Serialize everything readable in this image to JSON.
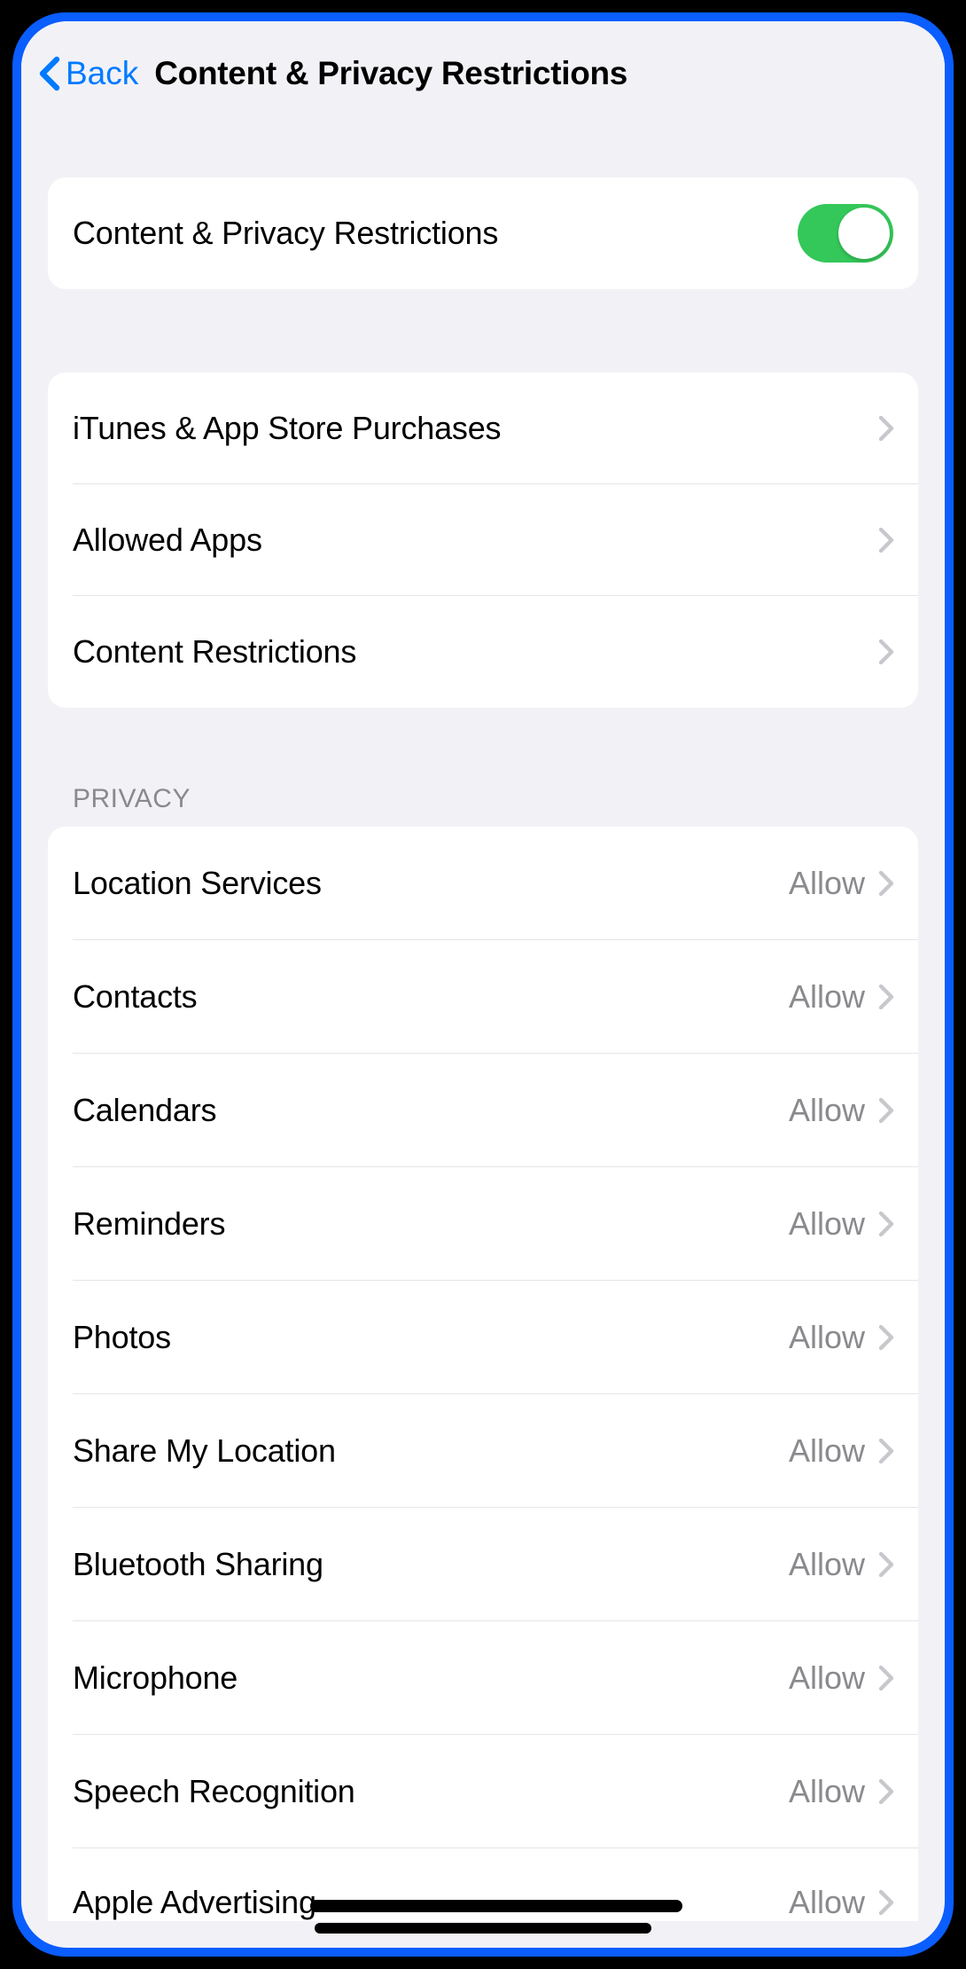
{
  "nav": {
    "back_label": "Back",
    "title": "Content & Privacy Restrictions"
  },
  "toggle_section": {
    "label": "Content & Privacy Restrictions",
    "enabled": true
  },
  "main_items": [
    {
      "label": "iTunes & App Store Purchases"
    },
    {
      "label": "Allowed Apps"
    },
    {
      "label": "Content Restrictions"
    }
  ],
  "privacy_header": "Privacy",
  "privacy_items": [
    {
      "label": "Location Services",
      "value": "Allow"
    },
    {
      "label": "Contacts",
      "value": "Allow"
    },
    {
      "label": "Calendars",
      "value": "Allow"
    },
    {
      "label": "Reminders",
      "value": "Allow"
    },
    {
      "label": "Photos",
      "value": "Allow"
    },
    {
      "label": "Share My Location",
      "value": "Allow"
    },
    {
      "label": "Bluetooth Sharing",
      "value": "Allow"
    },
    {
      "label": "Microphone",
      "value": "Allow"
    },
    {
      "label": "Speech Recognition",
      "value": "Allow"
    },
    {
      "label": "Apple Advertising",
      "value": "Allow"
    }
  ]
}
